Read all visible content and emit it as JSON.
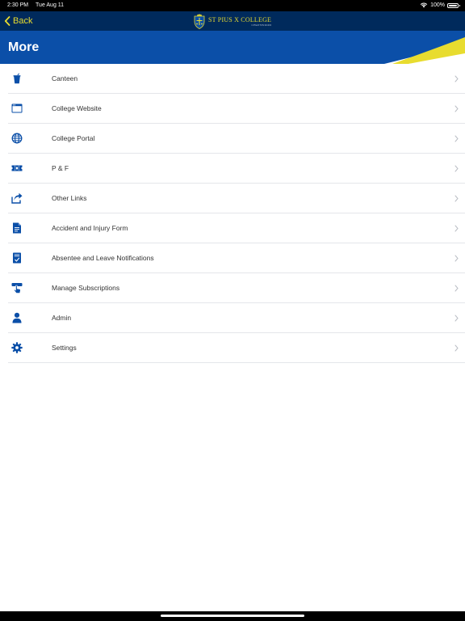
{
  "status_bar": {
    "time": "2:30 PM",
    "date": "Tue Aug 11",
    "battery": "100%"
  },
  "nav": {
    "back_label": "Back",
    "school_name": "ST PIUS X COLLEGE",
    "school_suburb": "CHATSWOOD"
  },
  "header": {
    "title": "More"
  },
  "colors": {
    "nav_bg": "#002a5c",
    "header_bg": "#0b4fa8",
    "accent_yellow": "#e8dc2f",
    "icon_blue": "#0b4fa8"
  },
  "menu": {
    "items": [
      {
        "label": "Canteen",
        "icon": "cup-icon"
      },
      {
        "label": "College Website",
        "icon": "browser-window-icon"
      },
      {
        "label": "College Portal",
        "icon": "globe-icon"
      },
      {
        "label": "P & F",
        "icon": "ticket-icon"
      },
      {
        "label": "Other Links",
        "icon": "share-icon"
      },
      {
        "label": "Accident and Injury Form",
        "icon": "document-icon"
      },
      {
        "label": "Absentee and Leave Notifications",
        "icon": "checklist-document-icon"
      },
      {
        "label": "Manage Subscriptions",
        "icon": "tap-finger-icon"
      },
      {
        "label": "Admin",
        "icon": "person-icon"
      },
      {
        "label": "Settings",
        "icon": "gear-icon"
      }
    ]
  }
}
